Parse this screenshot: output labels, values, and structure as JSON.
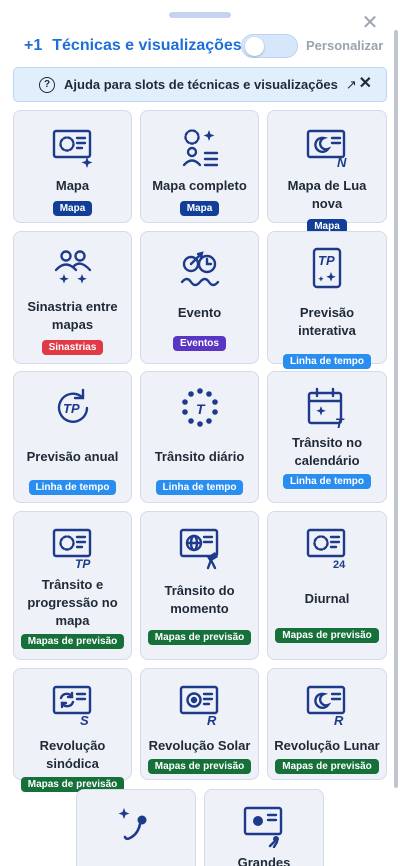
{
  "header": {
    "plus": "+1",
    "title": "Técnicas e visualizações",
    "close": "✕",
    "toggle_label": "Personalizar"
  },
  "help": {
    "icon": "?",
    "text": "Ajuda para slots de técnicas e visualizações",
    "arrow": "↗",
    "close": "✕"
  },
  "colors": {
    "accent": "#1e6fd9",
    "badge_mapa": "#123e98",
    "badge_sinastrias": "#e03a47",
    "badge_eventos": "#5b36c4",
    "badge_linha": "#2a8ef0",
    "badge_previsao": "#16703a"
  },
  "cards": [
    {
      "label": "Mapa",
      "badge": "Mapa",
      "icon": "natal-chart-icon"
    },
    {
      "label": "Mapa completo",
      "badge": "Mapa",
      "icon": "full-chart-icon"
    },
    {
      "label": "Mapa de Lua nova",
      "badge": "Mapa",
      "icon": "new-moon-chart-icon"
    },
    {
      "label": "Sinastria entre mapas",
      "badge": "Sinastrias",
      "icon": "synastry-icon"
    },
    {
      "label": "Evento",
      "badge": "Eventos",
      "icon": "event-icon"
    },
    {
      "label": "Previsão interativa",
      "badge": "Linha de tempo",
      "icon": "tp-card-icon"
    },
    {
      "label": "Previsão anual",
      "badge": "Linha de tempo",
      "icon": "annual-tp-icon"
    },
    {
      "label": "Trânsito diário",
      "badge": "Linha de tempo",
      "icon": "daily-transit-icon"
    },
    {
      "label": "Trânsito no calendário",
      "badge": "Linha de tempo",
      "icon": "calendar-transit-icon"
    },
    {
      "label": "Trânsito e progressão no mapa",
      "badge": "Mapas de previsão",
      "icon": "tp-chart-icon"
    },
    {
      "label": "Trânsito do momento",
      "badge": "Mapas de previsão",
      "icon": "globe-chart-icon"
    },
    {
      "label": "Diurnal",
      "badge": "Mapas de previsão",
      "icon": "diurnal-icon"
    },
    {
      "label": "Revolução sinódica",
      "badge": "Mapas de previsão",
      "icon": "synodic-return-icon"
    },
    {
      "label": "Revolução Solar",
      "badge": "Mapas de previsão",
      "icon": "solar-return-icon"
    },
    {
      "label": "Revolução Lunar",
      "badge": "Mapas de previsão",
      "icon": "lunar-return-icon"
    },
    {
      "label": "",
      "badge": "",
      "icon": "comet-icon"
    },
    {
      "label": "Grandes",
      "badge": "",
      "icon": "great-conjunction-icon"
    }
  ]
}
